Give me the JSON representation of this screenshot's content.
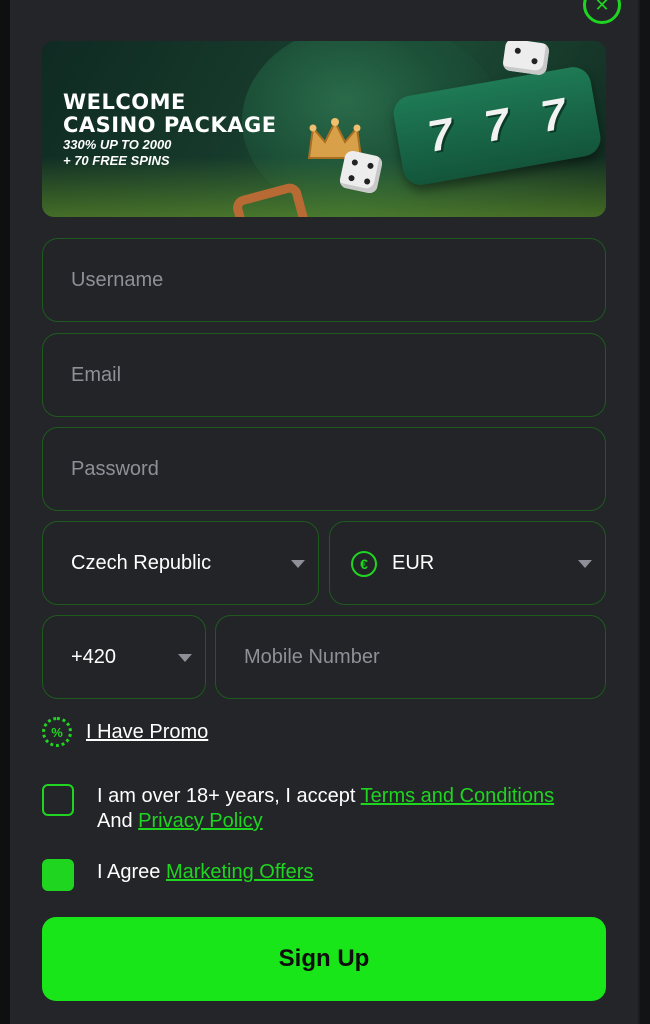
{
  "banner": {
    "title_line1": "WELCOME",
    "title_line2": "CASINO PACKAGE",
    "sub_line1": "330% UP TO 2000",
    "sub_line2": "+ 70 FREE SPINS",
    "reel_symbols": [
      "7",
      "7",
      "7"
    ]
  },
  "form": {
    "username_placeholder": "Username",
    "email_placeholder": "Email",
    "password_placeholder": "Password",
    "country_value": "Czech Republic",
    "currency_symbol": "€",
    "currency_value": "EUR",
    "phone_code": "+420",
    "mobile_placeholder": "Mobile Number"
  },
  "promo": {
    "icon_text": "%",
    "label": "I Have Promo"
  },
  "terms": {
    "text_before": "I am over 18+ years, I accept ",
    "terms_link": "Terms and Conditions",
    "and_text": "And ",
    "privacy_link": "Privacy Policy",
    "checked": false
  },
  "marketing": {
    "text_before": "I Agree ",
    "link": "Marketing Offers",
    "checked": true
  },
  "signup_label": "Sign Up",
  "close_symbol": "✕",
  "colors": {
    "accent": "#1fd51f",
    "button": "#19e619",
    "panel": "#232529",
    "field_border": "#1e5a1e"
  }
}
